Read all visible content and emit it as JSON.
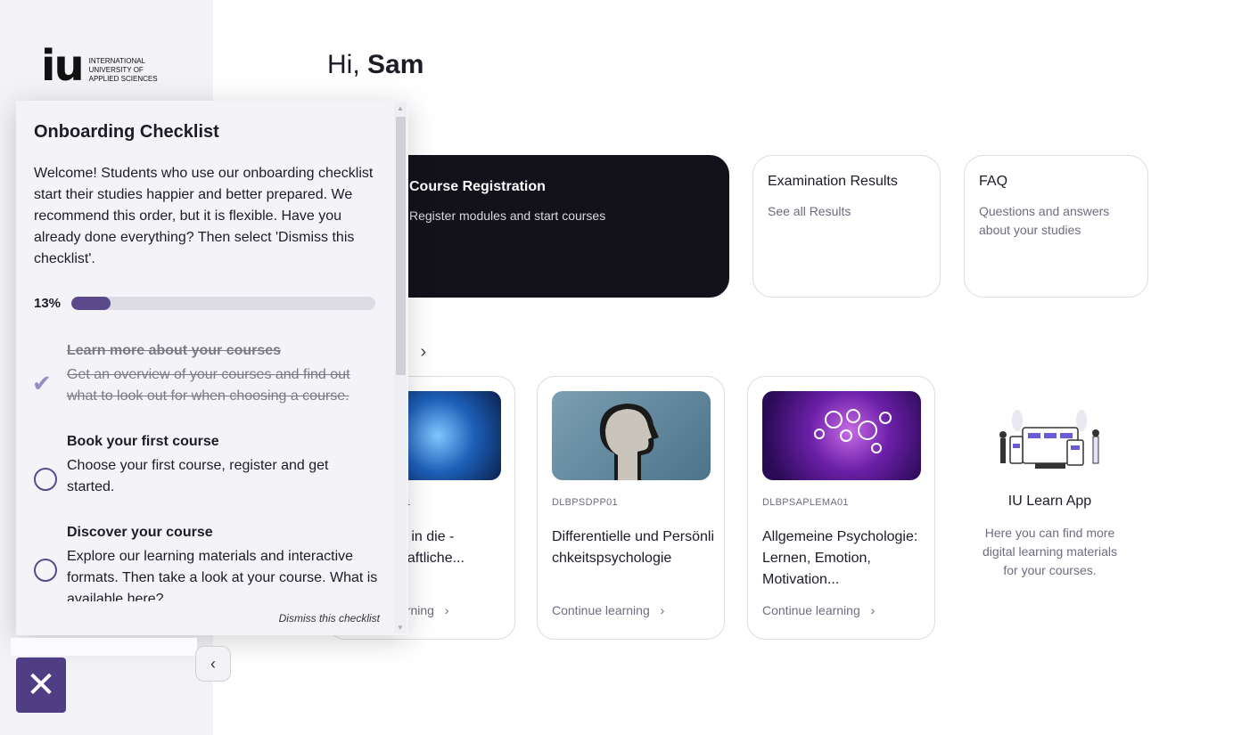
{
  "brand": {
    "mark": "iu",
    "text_line1": "International",
    "text_line2": "University of",
    "text_line3": "Applied Sciences"
  },
  "greeting": {
    "prefix": "Hi, ",
    "name": "Sam"
  },
  "cards": [
    {
      "title": "Course Registration",
      "subtitle": "Register modules and start courses"
    },
    {
      "title": "Examination Results",
      "subtitle": "See all Results"
    },
    {
      "title": "FAQ",
      "subtitle": "Questions and answers about your studies"
    }
  ],
  "section": {
    "label_fragment": "s",
    "chevron": "›"
  },
  "courses": [
    {
      "code": "01",
      "name": "g in die - naftliche...",
      "link": "arning"
    },
    {
      "code": "DLBPSDPP01",
      "name": "Differentielle und Persönlichkeitspsychologie",
      "link": "Continue learning"
    },
    {
      "code": "DLBPSAPLEMA01",
      "name": "Allgemeine Psychologie: Lernen, Emotion, Motivation...",
      "link": "Continue learning"
    }
  ],
  "app": {
    "title": "IU Learn App",
    "subtitle": "Here you can find more digital learning materials for your courses."
  },
  "checklist": {
    "title": "Onboarding Checklist",
    "intro": "Welcome! Students who use our onboarding checklist start their studies happier and better prepared. We recommend this order, but it is flexible. Have you already done everything? Then select 'Dismiss this checklist'.",
    "progress_label": "13%",
    "progress": 0.13,
    "items": [
      {
        "title": "Learn more about your courses",
        "desc": "Get an overview of your courses and find out what to look out for when choosing a course.",
        "done": true
      },
      {
        "title": "Book your first course",
        "desc": "Choose your first course, register and get started.",
        "done": false
      },
      {
        "title": "Discover your course",
        "desc": "Explore our learning materials and interactive formats. Then take a look at your course. What is available here?",
        "done": false
      }
    ],
    "dismiss": "Dismiss this checklist"
  },
  "icons": {
    "close": "close-icon",
    "collapse": "chevron-left-icon",
    "check": "checkmark-icon"
  },
  "colors": {
    "accent": "#5b4a8b",
    "dark_card": "#13121a"
  }
}
